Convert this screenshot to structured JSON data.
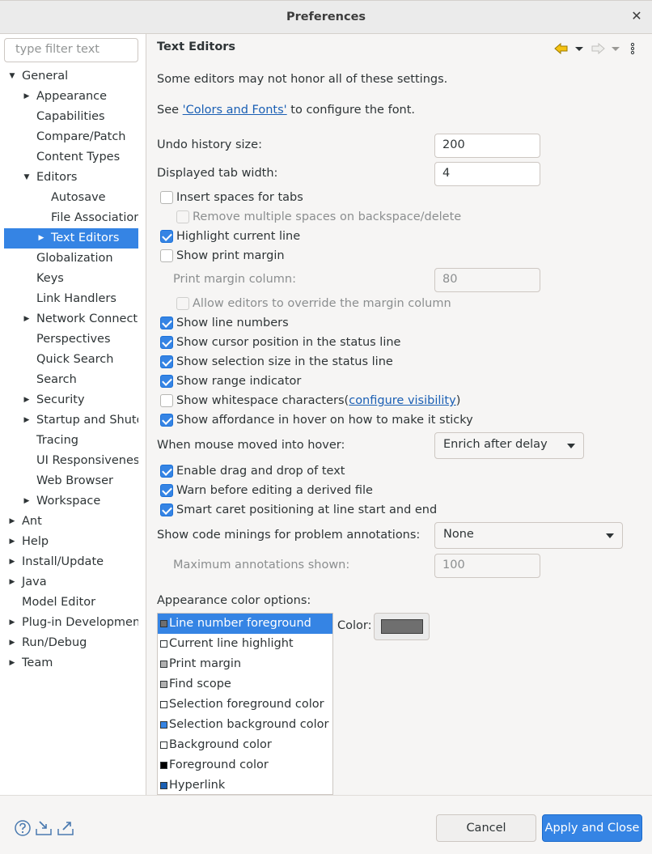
{
  "window": {
    "title": "Preferences",
    "close_glyph": "✕"
  },
  "filter": {
    "placeholder": "type filter text"
  },
  "tree": [
    {
      "label": "General"
    },
    {
      "label": "Appearance"
    },
    {
      "label": "Capabilities"
    },
    {
      "label": "Compare/Patch"
    },
    {
      "label": "Content Types"
    },
    {
      "label": "Editors"
    },
    {
      "label": "Autosave"
    },
    {
      "label": "File Associations"
    },
    {
      "label": "Text Editors"
    },
    {
      "label": "Globalization"
    },
    {
      "label": "Keys"
    },
    {
      "label": "Link Handlers"
    },
    {
      "label": "Network Connections"
    },
    {
      "label": "Perspectives"
    },
    {
      "label": "Quick Search"
    },
    {
      "label": "Search"
    },
    {
      "label": "Security"
    },
    {
      "label": "Startup and Shutdown"
    },
    {
      "label": "Tracing"
    },
    {
      "label": "UI Responsiveness Monitoring"
    },
    {
      "label": "Web Browser"
    },
    {
      "label": "Workspace"
    },
    {
      "label": "Ant"
    },
    {
      "label": "Help"
    },
    {
      "label": "Install/Update"
    },
    {
      "label": "Java"
    },
    {
      "label": "Model Editor"
    },
    {
      "label": "Plug-in Development"
    },
    {
      "label": "Run/Debug"
    },
    {
      "label": "Team"
    }
  ],
  "page": {
    "title": "Text Editors",
    "note": "Some editors may not honor all of these settings.",
    "see_prefix": "See ",
    "colors_link": "'Colors and Fonts'",
    "see_suffix": " to configure the font.",
    "undo_label": "Undo history size:",
    "undo_value": "200",
    "tab_label": "Displayed tab width:",
    "tab_value": "4",
    "print_margin_col_label": "Print margin column:",
    "print_margin_col_value": "80",
    "hover_label": "When mouse moved into hover:",
    "hover_value": "Enrich after delay",
    "minings_label": "Show code minings for problem annotations:",
    "minings_value": "None",
    "max_annotations_label": "Maximum annotations shown:",
    "max_annotations_value": "100",
    "appearance_colors_label": "Appearance color options:",
    "color_label": "Color:",
    "color_value": "#6f6f6f",
    "whitespace_prefix": "Show whitespace characters(",
    "whitespace_link": "configure visibility",
    "whitespace_suffix": ")"
  },
  "checkboxes": [
    {
      "label": "Insert spaces for tabs",
      "checked": false
    },
    {
      "label": "Remove multiple spaces on backspace/delete",
      "checked": false
    },
    {
      "label": "Highlight current line",
      "checked": true
    },
    {
      "label": "Show print margin",
      "checked": false
    },
    {
      "label": "Allow editors to override the margin column",
      "checked": false
    },
    {
      "label": "Show line numbers",
      "checked": true
    },
    {
      "label": "Show cursor position in the status line",
      "checked": true
    },
    {
      "label": "Show selection size in the status line",
      "checked": true
    },
    {
      "label": "Show range indicator",
      "checked": true
    },
    {
      "label": "Show whitespace characters(configure visibility)",
      "checked": false
    },
    {
      "label": "Show affordance in hover on how to make it sticky",
      "checked": true
    },
    {
      "label": "Enable drag and drop of text",
      "checked": true
    },
    {
      "label": "Warn before editing a derived file",
      "checked": true
    },
    {
      "label": "Smart caret positioning at line start and end",
      "checked": true
    }
  ],
  "color_options": [
    {
      "label": "Line number foreground",
      "swatch": "#6f6f6f"
    },
    {
      "label": "Current line highlight",
      "swatch": "#ffffff"
    },
    {
      "label": "Print margin",
      "swatch": "#b0b0b0"
    },
    {
      "label": "Find scope",
      "swatch": "#b0b0b0"
    },
    {
      "label": "Selection foreground color",
      "swatch": "#ffffff"
    },
    {
      "label": "Selection background color",
      "swatch": "#3584e4"
    },
    {
      "label": "Background color",
      "swatch": "#ffffff"
    },
    {
      "label": "Foreground color",
      "swatch": "#000000"
    },
    {
      "label": "Hyperlink",
      "swatch": "#1a5fb4"
    }
  ],
  "buttons": {
    "cancel": "Cancel",
    "apply": "Apply and Close"
  },
  "colors": {
    "accent": "#3584e4",
    "link": "#1a5fb4"
  }
}
